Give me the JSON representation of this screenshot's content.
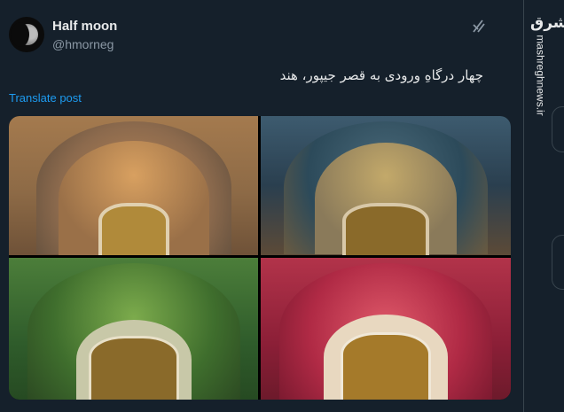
{
  "author": {
    "name": "Half moon",
    "handle": "@hmorneg"
  },
  "tweet": {
    "text": "چهار درگاهِ ورودی به قصر جیپور، هند",
    "translate_label": "Translate post"
  },
  "media": {
    "images": [
      {
        "icon": "gate-orange-icon"
      },
      {
        "icon": "gate-peacock-icon"
      },
      {
        "icon": "gate-green-icon"
      },
      {
        "icon": "gate-rose-icon"
      }
    ]
  },
  "watermark": {
    "logo": "مشرق",
    "url": "mashreghnews.ir"
  },
  "colors": {
    "background": "#15202b",
    "link": "#1d9bf0",
    "secondary_text": "#8b98a5"
  }
}
